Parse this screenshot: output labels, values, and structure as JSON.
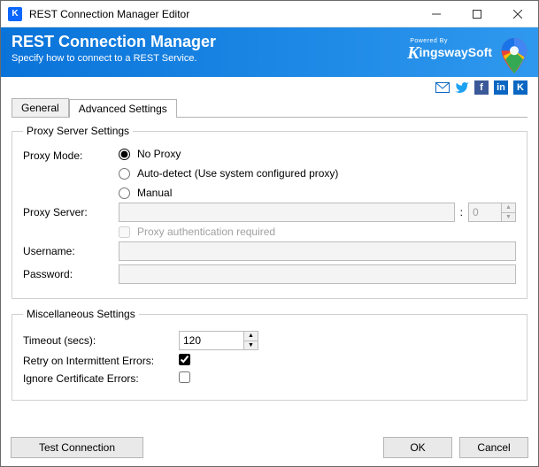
{
  "window": {
    "title": "REST Connection Manager Editor"
  },
  "header": {
    "title": "REST Connection Manager",
    "subtitle": "Specify how to connect to a REST Service.",
    "poweredBy": "Powered By",
    "brand": "KingswaySoft"
  },
  "tabs": [
    {
      "label": "General"
    },
    {
      "label": "Advanced Settings"
    }
  ],
  "proxy": {
    "legend": "Proxy Server Settings",
    "modeLabel": "Proxy Mode:",
    "options": {
      "noProxy": "No Proxy",
      "autoDetect": "Auto-detect (Use system configured proxy)",
      "manual": "Manual"
    },
    "serverLabel": "Proxy Server:",
    "serverValue": "",
    "portSep": ":",
    "portValue": "0",
    "authRequiredLabel": "Proxy authentication required",
    "usernameLabel": "Username:",
    "usernameValue": "",
    "passwordLabel": "Password:",
    "passwordValue": ""
  },
  "misc": {
    "legend": "Miscellaneous Settings",
    "timeoutLabel": "Timeout (secs):",
    "timeoutValue": "120",
    "retryLabel": "Retry on Intermittent Errors:",
    "retryChecked": true,
    "ignoreCertLabel": "Ignore Certificate Errors:",
    "ignoreCertChecked": false
  },
  "footer": {
    "testConnection": "Test Connection",
    "ok": "OK",
    "cancel": "Cancel"
  }
}
